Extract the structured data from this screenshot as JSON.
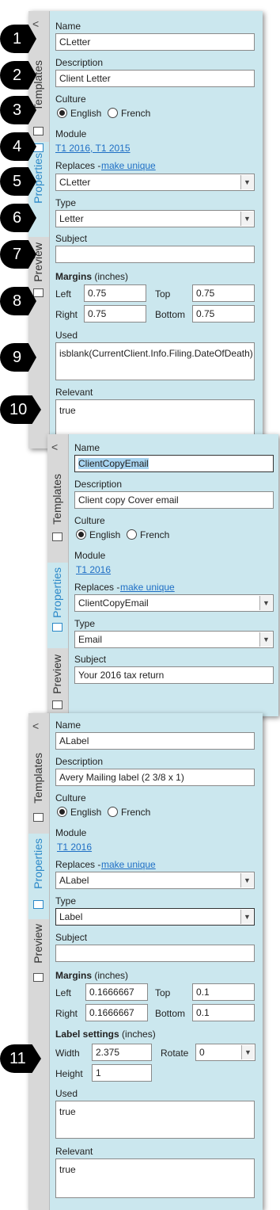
{
  "tabs": {
    "collapse": "<",
    "templates": "Templates",
    "properties": "Properties",
    "preview": "Preview"
  },
  "labels": {
    "name": "Name",
    "description": "Description",
    "culture": "Culture",
    "module": "Module",
    "replaces": "Replaces - ",
    "make_unique": "make unique",
    "type": "Type",
    "subject": "Subject",
    "margins": "Margins",
    "inches": "(inches)",
    "left": "Left",
    "top": "Top",
    "right": "Right",
    "bottom": "Bottom",
    "used": "Used",
    "relevant": "Relevant",
    "label_settings": "Label settings",
    "width": "Width",
    "rotate": "Rotate",
    "height": "Height",
    "english": "English",
    "french": "French"
  },
  "panel1": {
    "name": "CLetter",
    "description": "Client Letter",
    "module": "T1 2016, T1 2015",
    "replaces": "CLetter",
    "type": "Letter",
    "subject": "",
    "margin_left": "0.75",
    "margin_top": "0.75",
    "margin_right": "0.75",
    "margin_bottom": "0.75",
    "used": "isblank(CurrentClient.Info.Filing.DateOfDeath)",
    "relevant": "true"
  },
  "panel2": {
    "name": "ClientCopyEmail",
    "description": "Client copy Cover email",
    "module": "T1 2016",
    "replaces": "ClientCopyEmail",
    "type": "Email",
    "subject": "Your 2016 tax return"
  },
  "panel3": {
    "name": "ALabel",
    "description": "Avery Mailing label (2 3/8 x 1)",
    "module": "T1 2016",
    "replaces": "ALabel",
    "type": "Label",
    "subject": "",
    "margin_left": "0.1666667",
    "margin_top": "0.1",
    "margin_right": "0.1666667",
    "margin_bottom": "0.1",
    "width": "2.375",
    "rotate": "0",
    "height": "1",
    "used": "true",
    "relevant": "true"
  },
  "callouts": [
    "1",
    "2",
    "3",
    "4",
    "5",
    "6",
    "7",
    "8",
    "9",
    "10",
    "11"
  ]
}
